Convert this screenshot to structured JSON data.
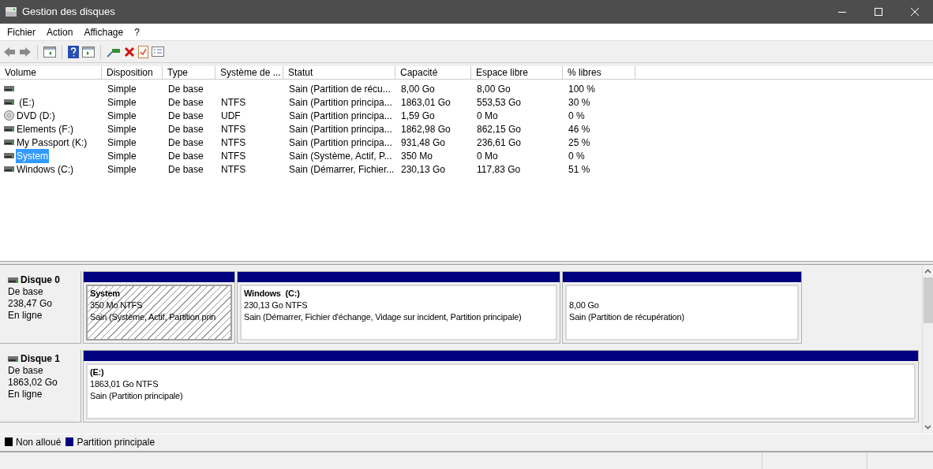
{
  "window": {
    "title": "Gestion des disques"
  },
  "menu": [
    "Fichier",
    "Action",
    "Affichage",
    "?"
  ],
  "table": {
    "columns": [
      "Volume",
      "Disposition",
      "Type",
      "Système de ...",
      "Statut",
      "Capacité",
      "Espace libre",
      "% libres"
    ],
    "rows": [
      {
        "kind": "disk",
        "selected": false,
        "cells": [
          "",
          "Simple",
          "De base",
          "",
          "Sain (Partition de récu...",
          "8,00 Go",
          "8,00 Go",
          "100 %"
        ]
      },
      {
        "kind": "disk",
        "selected": false,
        "cells": [
          " (E:)",
          "Simple",
          "De base",
          "NTFS",
          "Sain (Partition principa...",
          "1863,01 Go",
          "553,53 Go",
          "30 %"
        ]
      },
      {
        "kind": "dvd",
        "selected": false,
        "cells": [
          "DVD (D:)",
          "Simple",
          "De base",
          "UDF",
          "Sain (Partition principa...",
          "1,59 Go",
          "0 Mo",
          "0 %"
        ]
      },
      {
        "kind": "disk",
        "selected": false,
        "cells": [
          "Elements (F:)",
          "Simple",
          "De base",
          "NTFS",
          "Sain (Partition principa...",
          "1862,98 Go",
          "862,15 Go",
          "46 %"
        ]
      },
      {
        "kind": "disk",
        "selected": false,
        "cells": [
          "My Passport (K:)",
          "Simple",
          "De base",
          "NTFS",
          "Sain (Partition principa...",
          "931,48 Go",
          "236,61 Go",
          "25 %"
        ]
      },
      {
        "kind": "disk",
        "selected": true,
        "cells": [
          "System",
          "Simple",
          "De base",
          "NTFS",
          "Sain (Système, Actif, P...",
          "350 Mo",
          "0 Mo",
          "0 %"
        ]
      },
      {
        "kind": "disk",
        "selected": false,
        "cells": [
          "Windows (C:)",
          "Simple",
          "De base",
          "NTFS",
          "Sain (Démarrer, Fichier...",
          "230,13 Go",
          "117,83 Go",
          "51 %"
        ]
      }
    ]
  },
  "disks": [
    {
      "name": "Disque 0",
      "type": "De base",
      "size": "238,47 Go",
      "state": "En ligne",
      "partitions": [
        {
          "name": "System",
          "size": "350 Mo NTFS",
          "status": "Sain (Système, Actif, Partition prin",
          "selected": true
        },
        {
          "name": "Windows  (C:)",
          "size": "230,13 Go NTFS",
          "status": "Sain (Démarrer, Fichier d'échange, Vidage sur incident, Partition principale)",
          "selected": false
        },
        {
          "size": "8,00 Go",
          "status": "Sain (Partition de récupération)",
          "selected": false
        }
      ]
    },
    {
      "name": "Disque 1",
      "type": "De base",
      "size": "1863,02 Go",
      "state": "En ligne",
      "partitions": [
        {
          "name": "(E:)",
          "size": "1863,01 Go NTFS",
          "status": "Sain (Partition principale)",
          "selected": false
        }
      ]
    }
  ],
  "legend": [
    {
      "label": "Non alloué",
      "color": "#000000"
    },
    {
      "label": "Partition principale",
      "color": "#000080"
    }
  ]
}
